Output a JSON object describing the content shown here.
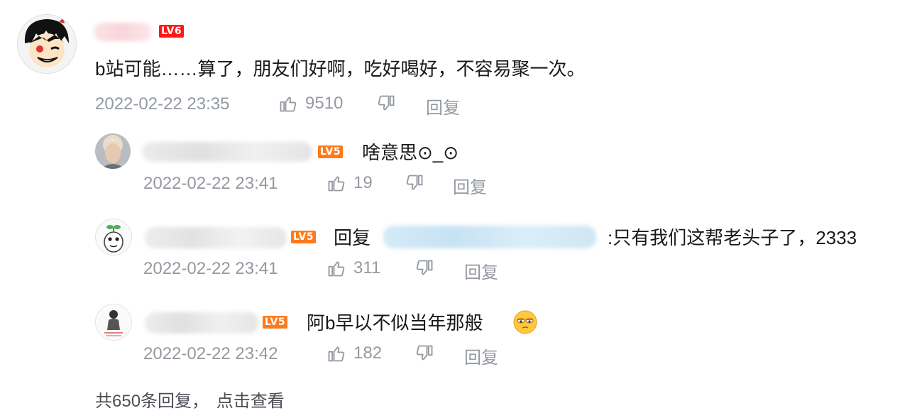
{
  "main_comment": {
    "level": "LV6",
    "text": "b站可能……算了，朋友们好啊，吃好喝好，不容易聚一次。",
    "time": "2022-02-22 23:35",
    "likes": "9510",
    "reply_label": "回复"
  },
  "replies": [
    {
      "level": "LV5",
      "text": "啥意思⊙_⊙",
      "time": "2022-02-22 23:41",
      "likes": "19",
      "reply_label": "回复"
    },
    {
      "level": "LV5",
      "prefix": "回复",
      "text": ":只有我们这帮老头子了，2333",
      "time": "2022-02-22 23:41",
      "likes": "311",
      "reply_label": "回复"
    },
    {
      "level": "LV5",
      "text": "阿b早以不似当年那般",
      "time": "2022-02-22 23:42",
      "likes": "182",
      "reply_label": "回复"
    }
  ],
  "more_replies": {
    "text": "共650条回复，",
    "link": "点击查看"
  },
  "colors": {
    "lv6": "#ff1818",
    "lv5": "#ff7a1a",
    "meta": "#9499a0"
  }
}
